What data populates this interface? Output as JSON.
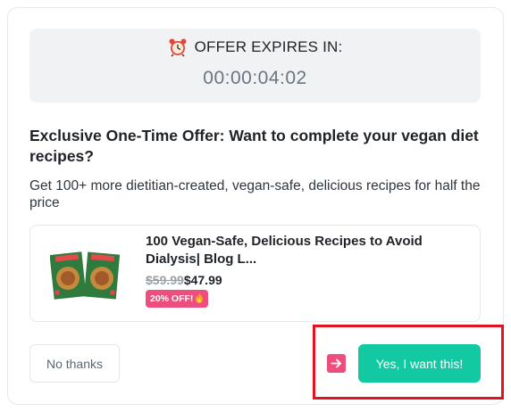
{
  "timer": {
    "label": "OFFER EXPIRES IN:",
    "value": "00:00:04:02",
    "icon": "alarm-clock-icon"
  },
  "offer": {
    "headline": "Exclusive One-Time Offer: Want to complete your vegan diet recipes?",
    "description": "Get 100+ more dietitian-created, vegan-safe, delicious recipes for half the price"
  },
  "product": {
    "title": "100 Vegan-Safe, Delicious Recipes to Avoid Dialysis| Blog L...",
    "old_price": "$59.99",
    "new_price": "$47.99",
    "badge": "20% OFF!",
    "badge_icon": "fire-icon"
  },
  "actions": {
    "decline_label": "No thanks",
    "accept_label": "Yes, I want this!",
    "arrow_icon": "arrow-right-icon"
  },
  "colors": {
    "accent": "#12c9a1",
    "badge": "#ec4f7d",
    "highlight": "#e0141e"
  }
}
